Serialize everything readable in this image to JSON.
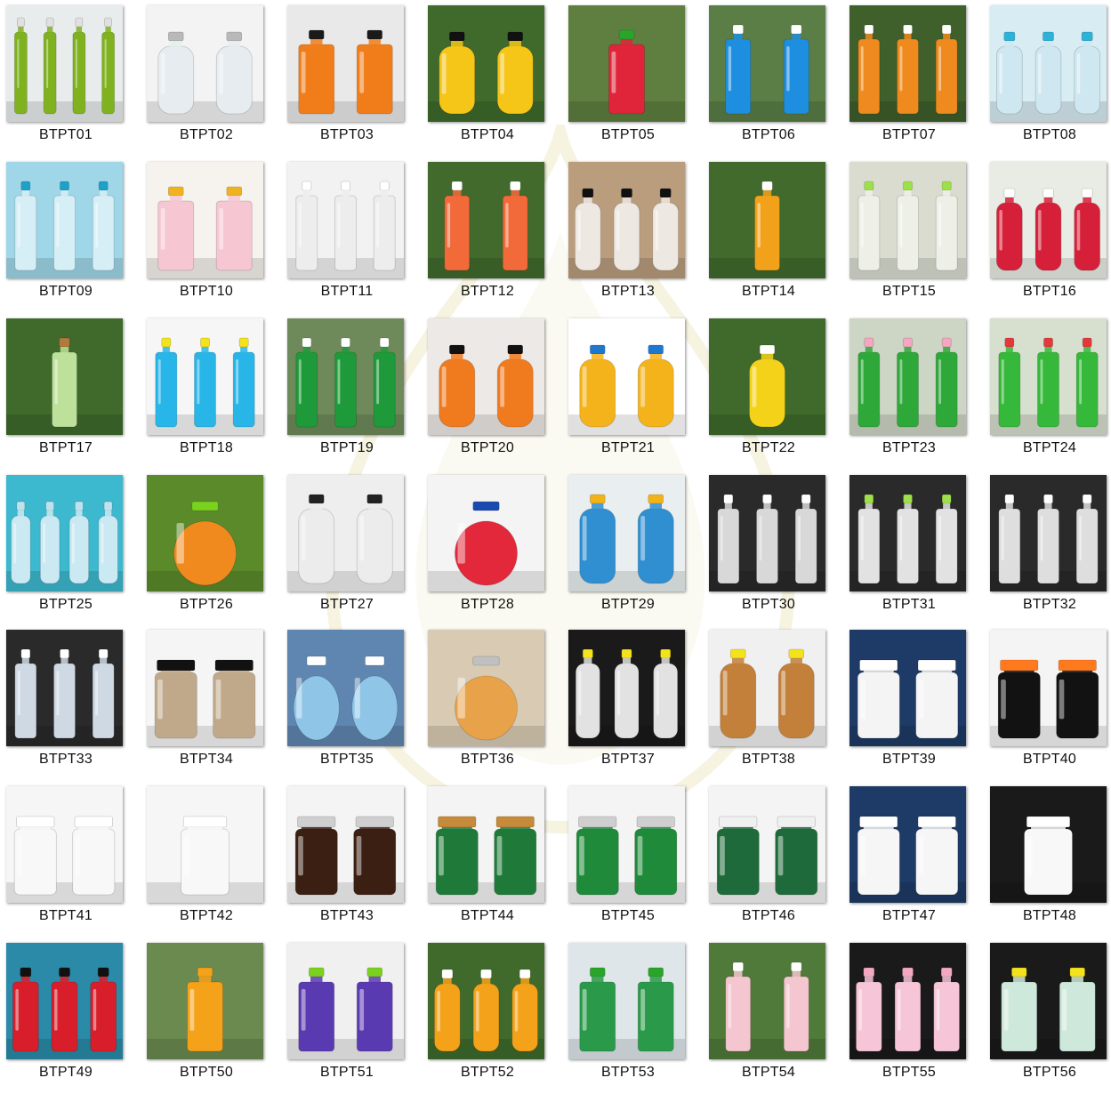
{
  "gallery": {
    "items": [
      {
        "label": "BTPT01",
        "bg": "#e9ecec",
        "liquid": "#7fb21e",
        "cap": "#e0e0e0",
        "count": 4,
        "shape": "tube"
      },
      {
        "label": "BTPT02",
        "bg": "#f3f3f3",
        "liquid": "#e6ecef",
        "cap": "#b9b9b9",
        "count": 2,
        "shape": "round"
      },
      {
        "label": "BTPT03",
        "bg": "#e9e9e9",
        "liquid": "#f07d1a",
        "cap": "#1a1a1a",
        "count": 2,
        "shape": "square"
      },
      {
        "label": "BTPT04",
        "bg": "#3f6a2c",
        "liquid": "#f5c518",
        "cap": "#111111",
        "count": 2,
        "shape": "round"
      },
      {
        "label": "BTPT05",
        "bg": "#5f7f40",
        "liquid": "#e0243a",
        "cap": "#2aa52a",
        "count": 1,
        "shape": "square"
      },
      {
        "label": "BTPT06",
        "bg": "#5a7e46",
        "liquid": "#1e8fe0",
        "cap": "#ffffff",
        "count": 2,
        "shape": "tall"
      },
      {
        "label": "BTPT07",
        "bg": "#3f5f2b",
        "liquid": "#ef8a1e",
        "cap": "#ffffff",
        "count": 3,
        "shape": "tall"
      },
      {
        "label": "BTPT08",
        "bg": "#d8ecf3",
        "liquid": "#cfe7f0",
        "cap": "#2fb1d8",
        "count": 3,
        "shape": "round"
      },
      {
        "label": "BTPT09",
        "bg": "#9fd7e8",
        "liquid": "#d6eef5",
        "cap": "#1fa0c8",
        "count": 3,
        "shape": "tall"
      },
      {
        "label": "BTPT10",
        "bg": "#f6f3ee",
        "liquid": "#f6c6d2",
        "cap": "#f0b21e",
        "count": 2,
        "shape": "square"
      },
      {
        "label": "BTPT11",
        "bg": "#f2f2f2",
        "liquid": "#ededed",
        "cap": "#ffffff",
        "count": 3,
        "shape": "tall"
      },
      {
        "label": "BTPT12",
        "bg": "#416a2c",
        "liquid": "#f26a3a",
        "cap": "#ffffff",
        "count": 2,
        "shape": "tall"
      },
      {
        "label": "BTPT13",
        "bg": "#b99d7d",
        "liquid": "#ede8e2",
        "cap": "#111111",
        "count": 3,
        "shape": "round"
      },
      {
        "label": "BTPT14",
        "bg": "#416a2c",
        "liquid": "#f2a21a",
        "cap": "#ffffff",
        "count": 1,
        "shape": "tall"
      },
      {
        "label": "BTPT15",
        "bg": "#d9dccf",
        "liquid": "#eef0e8",
        "cap": "#9ee04a",
        "count": 3,
        "shape": "tall"
      },
      {
        "label": "BTPT16",
        "bg": "#e9ece4",
        "liquid": "#d6203a",
        "cap": "#ffffff",
        "count": 3,
        "shape": "round"
      },
      {
        "label": "BTPT17",
        "bg": "#3f6a2c",
        "liquid": "#bde09a",
        "cap": "#b07a3a",
        "count": 1,
        "shape": "tall"
      },
      {
        "label": "BTPT18",
        "bg": "#f6f6f6",
        "liquid": "#28b6e8",
        "cap": "#f4e21a",
        "count": 3,
        "shape": "tall"
      },
      {
        "label": "BTPT19",
        "bg": "#6f8a5a",
        "liquid": "#1f9a3a",
        "cap": "#ffffff",
        "count": 3,
        "shape": "tall"
      },
      {
        "label": "BTPT20",
        "bg": "#ece9e6",
        "liquid": "#f07a1e",
        "cap": "#111111",
        "count": 2,
        "shape": "round"
      },
      {
        "label": "BTPT21",
        "bg": "#ffffff",
        "liquid": "#f4b31a",
        "cap": "#1e78d0",
        "count": 2,
        "shape": "round"
      },
      {
        "label": "BTPT22",
        "bg": "#3f6a2c",
        "liquid": "#f4d21a",
        "cap": "#ffffff",
        "count": 1,
        "shape": "round"
      },
      {
        "label": "BTPT23",
        "bg": "#cdd5c5",
        "liquid": "#2fa83a",
        "cap": "#f4a8c0",
        "count": 3,
        "shape": "tall"
      },
      {
        "label": "BTPT24",
        "bg": "#d7dfcf",
        "liquid": "#36b83a",
        "cap": "#e23a3a",
        "count": 3,
        "shape": "tall"
      },
      {
        "label": "BTPT25",
        "bg": "#3cb8cf",
        "liquid": "#cbe9f2",
        "cap": "#bfe3ee",
        "count": 4,
        "shape": "round"
      },
      {
        "label": "BTPT26",
        "bg": "#5a8a2a",
        "liquid": "#f08a1e",
        "cap": "#7ad11e",
        "count": 1,
        "shape": "globe"
      },
      {
        "label": "BTPT27",
        "bg": "#eeeeee",
        "liquid": "#ececec",
        "cap": "#222222",
        "count": 2,
        "shape": "drop"
      },
      {
        "label": "BTPT28",
        "bg": "#f4f4f4",
        "liquid": "#e2283a",
        "cap": "#1a4ab0",
        "count": 1,
        "shape": "globe"
      },
      {
        "label": "BTPT29",
        "bg": "#e9eef0",
        "liquid": "#2f8fd0",
        "cap": "#f2b21a",
        "count": 2,
        "shape": "drop"
      },
      {
        "label": "BTPT30",
        "bg": "#2a2a2a",
        "liquid": "#d8d8d8",
        "cap": "#ffffff",
        "count": 3,
        "shape": "tall"
      },
      {
        "label": "BTPT31",
        "bg": "#2a2a2a",
        "liquid": "#e2e2e2",
        "cap": "#9ee04a",
        "count": 3,
        "shape": "tall"
      },
      {
        "label": "BTPT32",
        "bg": "#2a2a2a",
        "liquid": "#dedede",
        "cap": "#ffffff",
        "count": 3,
        "shape": "tall"
      },
      {
        "label": "BTPT33",
        "bg": "#2a2a2a",
        "liquid": "#cfd9e3",
        "cap": "#ffffff",
        "count": 3,
        "shape": "tall"
      },
      {
        "label": "BTPT34",
        "bg": "#f5f5f5",
        "liquid": "#bfa98a",
        "cap": "#111111",
        "count": 2,
        "shape": "jar"
      },
      {
        "label": "BTPT35",
        "bg": "#5f86b0",
        "liquid": "#8fc6e8",
        "cap": "#ffffff",
        "count": 2,
        "shape": "globe"
      },
      {
        "label": "BTPT36",
        "bg": "#d9cbb3",
        "liquid": "#e8a24a",
        "cap": "#c0c0c0",
        "count": 1,
        "shape": "globe"
      },
      {
        "label": "BTPT37",
        "bg": "#1a1a1a",
        "liquid": "#e2e2e2",
        "cap": "#f4e21a",
        "count": 3,
        "shape": "drop"
      },
      {
        "label": "BTPT38",
        "bg": "#f0f0f0",
        "liquid": "#c2803a",
        "cap": "#f4e21a",
        "count": 2,
        "shape": "drop"
      },
      {
        "label": "BTPT39",
        "bg": "#1d3b66",
        "liquid": "#f4f4f4",
        "cap": "#ffffff",
        "count": 2,
        "shape": "jar"
      },
      {
        "label": "BTPT40",
        "bg": "#f4f4f4",
        "liquid": "#121212",
        "cap": "#ff7a1e",
        "count": 2,
        "shape": "jar"
      },
      {
        "label": "BTPT41",
        "bg": "#f6f6f6",
        "liquid": "#f8f8f8",
        "cap": "#ffffff",
        "count": 2,
        "shape": "jar"
      },
      {
        "label": "BTPT42",
        "bg": "#f6f6f6",
        "liquid": "#f8f8f8",
        "cap": "#ffffff",
        "count": 1,
        "shape": "jar"
      },
      {
        "label": "BTPT43",
        "bg": "#f4f4f4",
        "liquid": "#3a1f12",
        "cap": "#cfcfcf",
        "count": 2,
        "shape": "jar"
      },
      {
        "label": "BTPT44",
        "bg": "#f4f4f4",
        "liquid": "#1f7a3a",
        "cap": "#c58a3a",
        "count": 2,
        "shape": "jar"
      },
      {
        "label": "BTPT45",
        "bg": "#f4f4f4",
        "liquid": "#1f8a3a",
        "cap": "#cfcfcf",
        "count": 2,
        "shape": "jar"
      },
      {
        "label": "BTPT46",
        "bg": "#f4f4f4",
        "liquid": "#1f6a3a",
        "cap": "#f0f0f0",
        "count": 2,
        "shape": "jar"
      },
      {
        "label": "BTPT47",
        "bg": "#1d3b66",
        "liquid": "#f6f6f6",
        "cap": "#ffffff",
        "count": 2,
        "shape": "jar"
      },
      {
        "label": "BTPT48",
        "bg": "#1a1a1a",
        "liquid": "#f8f8f8",
        "cap": "#ffffff",
        "count": 1,
        "shape": "jar"
      },
      {
        "label": "BTPT49",
        "bg": "#2a8aa8",
        "liquid": "#d81e2a",
        "cap": "#111111",
        "count": 3,
        "shape": "square"
      },
      {
        "label": "BTPT50",
        "bg": "#6a8a50",
        "liquid": "#f4a21a",
        "cap": "#f4a21a",
        "count": 1,
        "shape": "square"
      },
      {
        "label": "BTPT51",
        "bg": "#f0f0f0",
        "liquid": "#5a3ab0",
        "cap": "#7ad11e",
        "count": 2,
        "shape": "square"
      },
      {
        "label": "BTPT52",
        "bg": "#3f6a2c",
        "liquid": "#f4a21a",
        "cap": "#ffffff",
        "count": 3,
        "shape": "round"
      },
      {
        "label": "BTPT53",
        "bg": "#dfe6ea",
        "liquid": "#2a9a4a",
        "cap": "#2aa52a",
        "count": 2,
        "shape": "square"
      },
      {
        "label": "BTPT54",
        "bg": "#4f7a3a",
        "liquid": "#f4c6cf",
        "cap": "#ffffff",
        "count": 2,
        "shape": "tall"
      },
      {
        "label": "BTPT55",
        "bg": "#1a1a1a",
        "liquid": "#f6c6d8",
        "cap": "#f4a8c0",
        "count": 3,
        "shape": "square"
      },
      {
        "label": "BTPT56",
        "bg": "#1a1a1a",
        "liquid": "#cfe8dc",
        "cap": "#f4e21a",
        "count": 2,
        "shape": "square"
      }
    ]
  }
}
